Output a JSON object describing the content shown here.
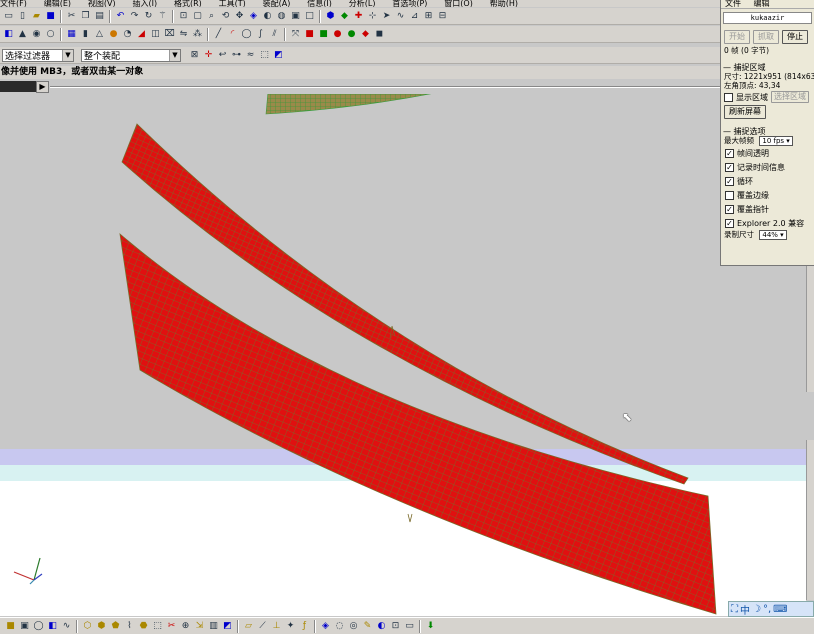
{
  "menu": [
    "文件(F)",
    "编辑(E)",
    "视图(V)",
    "插入(I)",
    "格式(R)",
    "工具(T)",
    "装配(A)",
    "信息(I)",
    "分析(L)",
    "首选项(P)",
    "窗口(O)",
    "帮助(H)"
  ],
  "filter": {
    "label": "选择过滤器",
    "assembly": "整个装配"
  },
  "prompt": "像并使用 MB3，或者双击某一对象",
  "capture": {
    "menu_file": "文件",
    "menu_edit": "编辑",
    "title": "kukaazir",
    "start": "开始",
    "pause": "抓取",
    "stop": "停止",
    "frames": "0 帧 (0 字节)",
    "region_group": "捕捉区域",
    "size": "尺寸: 1221x951 (814x634)",
    "top_left": "左角顶点: 43,34",
    "show_region": "显示区域",
    "select_region": "选择区域",
    "refresh": "刷新屏幕",
    "options_group": "捕捉选项",
    "max_fps_label": "最大帧频",
    "max_fps": "10 fps",
    "opt_transparent": "帧间透明",
    "opt_timing": "记录时间信息",
    "opt_loop": "循环",
    "opt_border": "覆盖边缘",
    "opt_cursor": "覆盖指针",
    "opt_explorer": "Explorer 2.0 兼容",
    "record_size_label": "录制尺寸",
    "record_size": "44%"
  },
  "ime": {
    "lang": "中"
  },
  "colors": {
    "mesh": "#e01010",
    "mesh_line": "#7a6a2a",
    "bg_gray": "#c8c8c8",
    "bg_lav": "#c8c8f0",
    "bg_white": "#ffffff"
  }
}
